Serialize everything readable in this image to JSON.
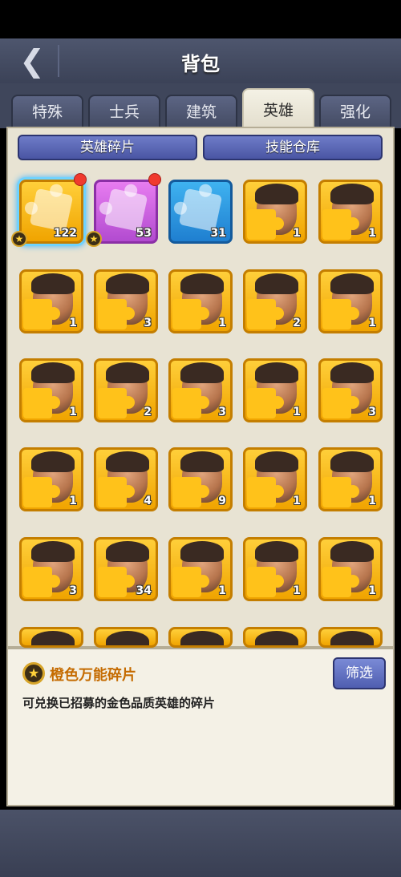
{
  "header": {
    "title": "背包",
    "back_icon": "chevron-left-icon"
  },
  "tabs": [
    {
      "label": "特殊",
      "active": false
    },
    {
      "label": "士兵",
      "active": false
    },
    {
      "label": "建筑",
      "active": false
    },
    {
      "label": "英雄",
      "active": true
    },
    {
      "label": "强化",
      "active": false
    }
  ],
  "subtabs": [
    {
      "label": "英雄碎片"
    },
    {
      "label": "技能仓库"
    }
  ],
  "items": [
    {
      "count": "122",
      "kind": "universal-orange",
      "new": true,
      "star": true
    },
    {
      "count": "53",
      "kind": "universal-purple",
      "new": true,
      "star": true
    },
    {
      "count": "31",
      "kind": "universal-blue",
      "new": false,
      "star": false
    },
    {
      "count": "1",
      "kind": "hero"
    },
    {
      "count": "1",
      "kind": "hero"
    },
    {
      "count": "1",
      "kind": "hero"
    },
    {
      "count": "3",
      "kind": "hero"
    },
    {
      "count": "1",
      "kind": "hero"
    },
    {
      "count": "2",
      "kind": "hero"
    },
    {
      "count": "1",
      "kind": "hero"
    },
    {
      "count": "1",
      "kind": "hero"
    },
    {
      "count": "2",
      "kind": "hero"
    },
    {
      "count": "3",
      "kind": "hero"
    },
    {
      "count": "1",
      "kind": "hero"
    },
    {
      "count": "3",
      "kind": "hero"
    },
    {
      "count": "1",
      "kind": "hero"
    },
    {
      "count": "4",
      "kind": "hero"
    },
    {
      "count": "9",
      "kind": "hero"
    },
    {
      "count": "1",
      "kind": "hero"
    },
    {
      "count": "1",
      "kind": "hero"
    },
    {
      "count": "3",
      "kind": "hero"
    },
    {
      "count": "34",
      "kind": "hero"
    },
    {
      "count": "1",
      "kind": "hero"
    },
    {
      "count": "1",
      "kind": "hero"
    },
    {
      "count": "1",
      "kind": "hero"
    },
    {
      "count": "",
      "kind": "hero"
    },
    {
      "count": "",
      "kind": "hero"
    },
    {
      "count": "",
      "kind": "hero"
    },
    {
      "count": "",
      "kind": "hero"
    },
    {
      "count": "",
      "kind": "hero"
    }
  ],
  "detail": {
    "title": "橙色万能碎片",
    "description": "可兑换已招募的金色品质英雄的碎片",
    "filter_label": "筛选"
  },
  "colors": {
    "accent_orange": "#c56b00",
    "new_dot": "#f03a2e",
    "selected_glow": "#6ed3ff"
  }
}
